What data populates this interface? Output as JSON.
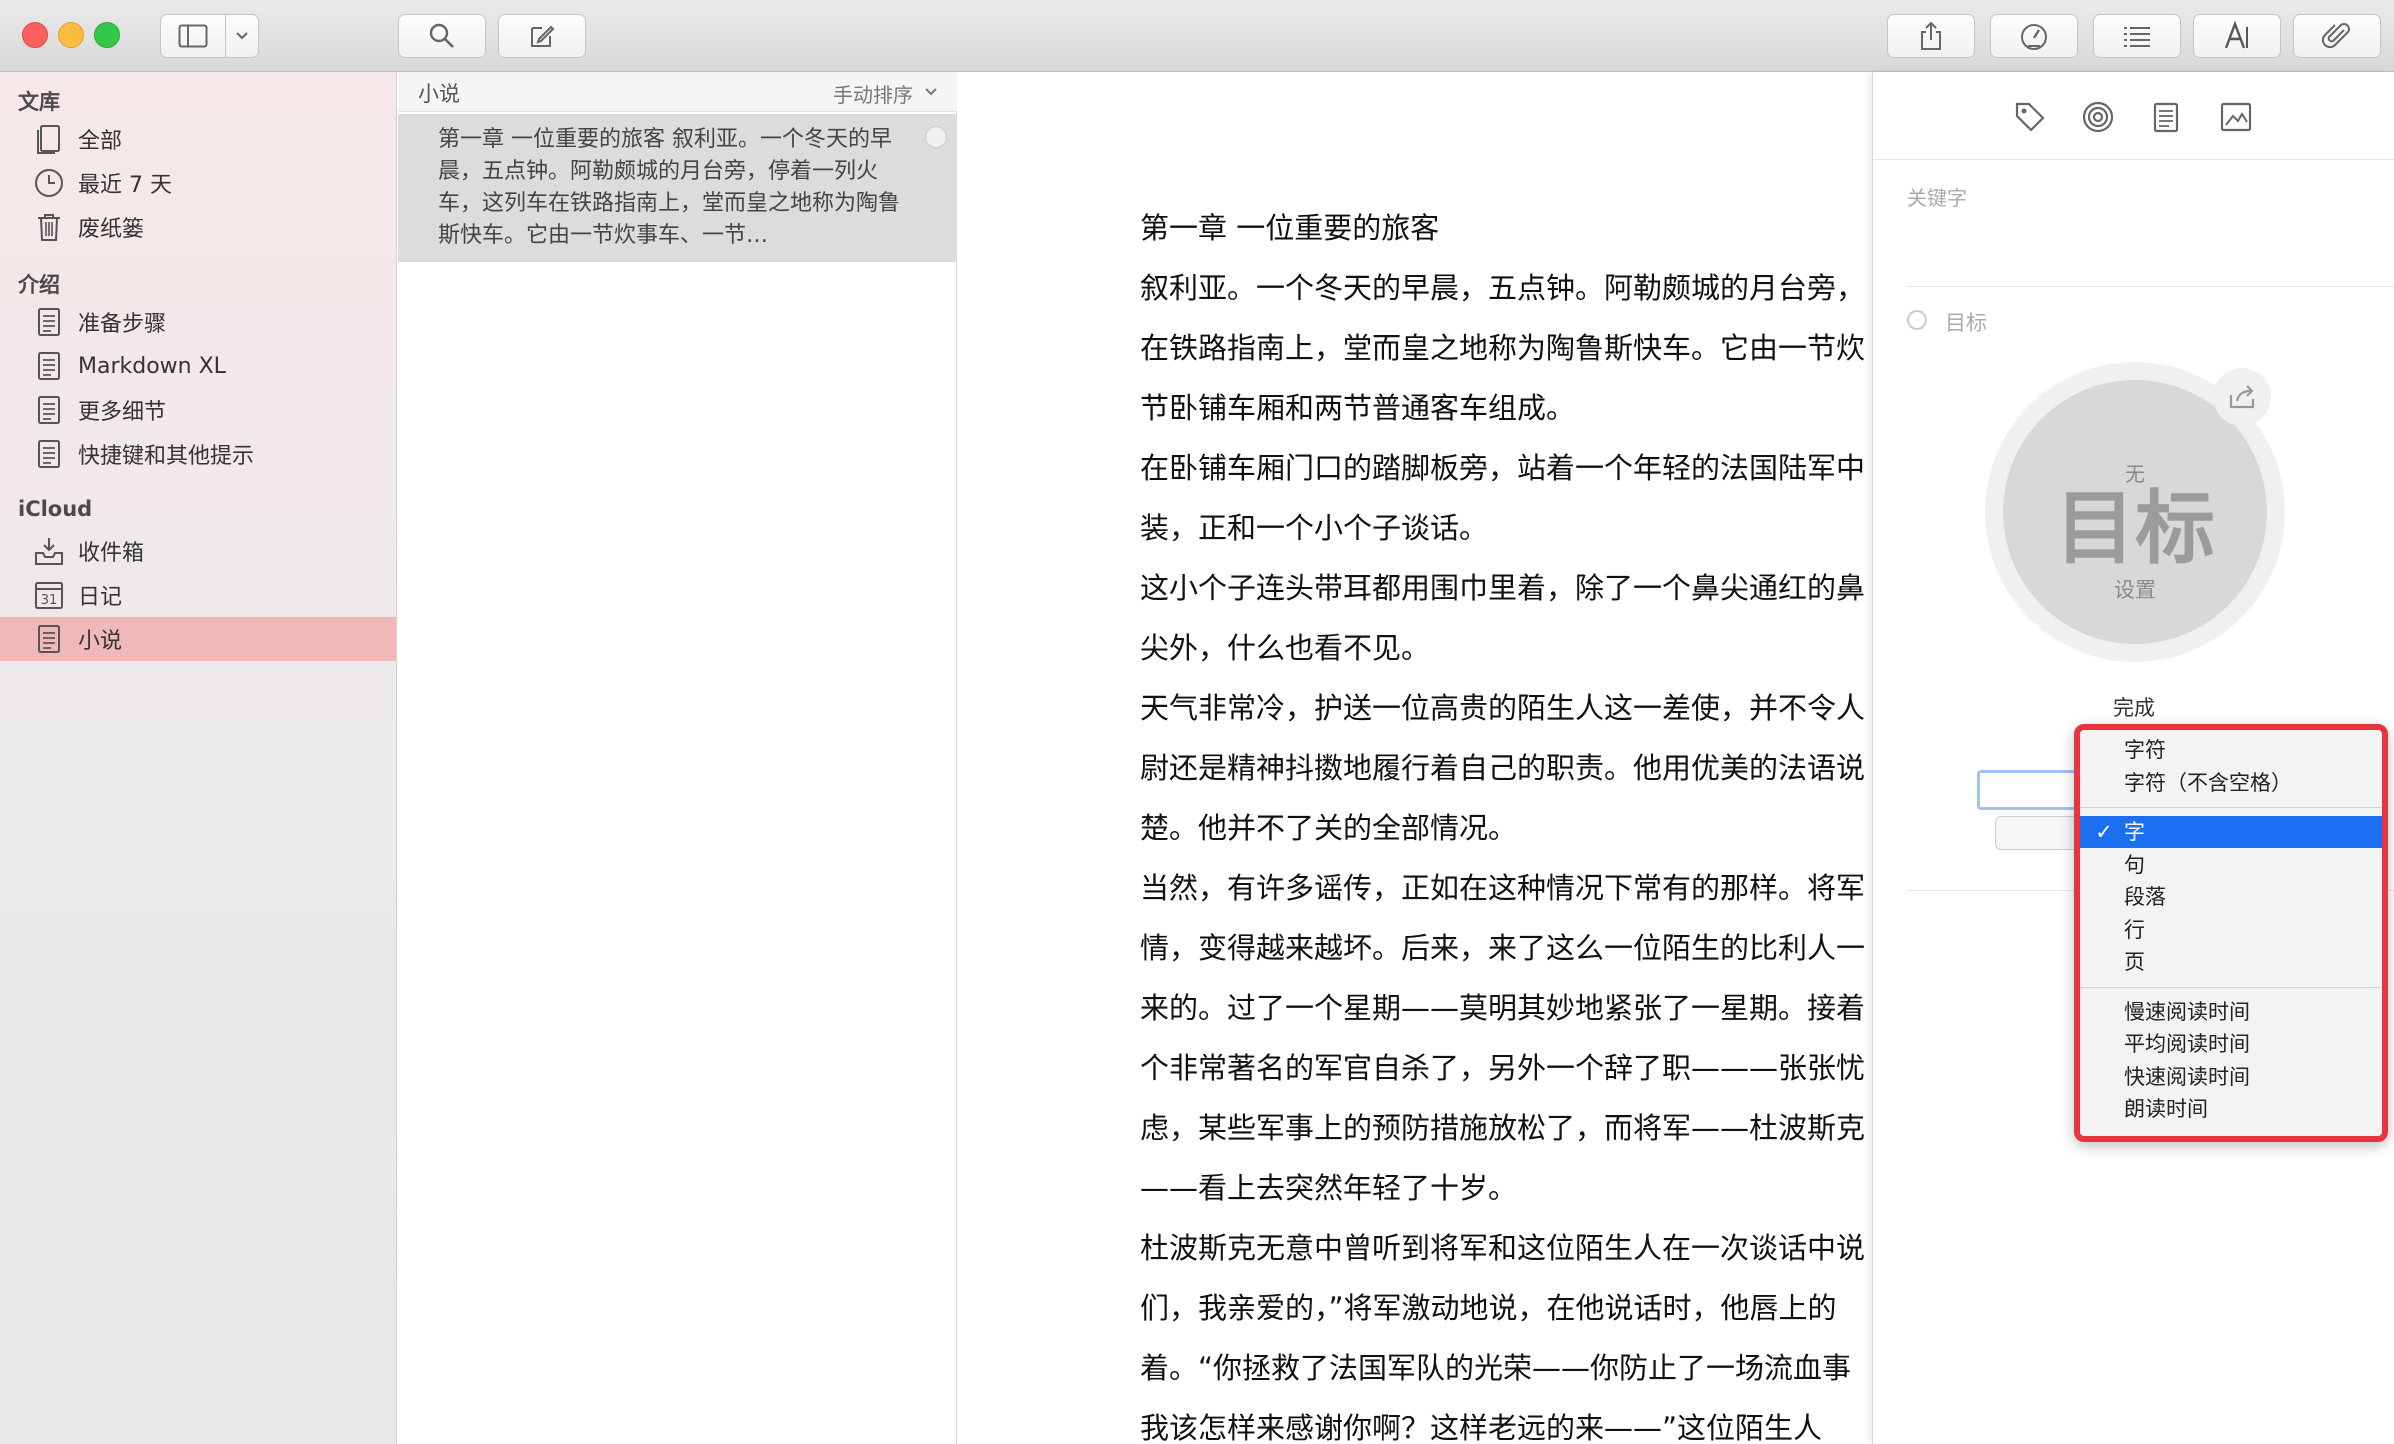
{
  "sidebar": {
    "sections": [
      {
        "title": "文库",
        "items": [
          {
            "label": "全部",
            "icon": "notes-stack-icon"
          },
          {
            "label": "最近 7 天",
            "icon": "clock-icon"
          },
          {
            "label": "废纸篓",
            "icon": "trash-icon"
          }
        ]
      },
      {
        "title": "介绍",
        "items": [
          {
            "label": "准备步骤",
            "icon": "document-icon"
          },
          {
            "label": "Markdown XL",
            "icon": "document-icon"
          },
          {
            "label": "更多细节",
            "icon": "document-icon"
          },
          {
            "label": "快捷键和其他提示",
            "icon": "document-icon"
          }
        ]
      },
      {
        "title": "iCloud",
        "items": [
          {
            "label": "收件箱",
            "icon": "inbox-icon"
          },
          {
            "label": "日记",
            "icon": "calendar-icon",
            "badge": "31"
          },
          {
            "label": "小说",
            "icon": "document-icon",
            "selected": true
          }
        ]
      }
    ]
  },
  "notelist": {
    "title": "小说",
    "sort": "手动排序",
    "items": [
      {
        "snippet": "第一章 一位重要的旅客 叙利亚。一个冬天的早晨，五点钟。阿勒颇城的月台旁，停着一列火车，这列车在铁路指南上，堂而皇之地称为陶鲁斯快车。它由一节炊事车、一节…"
      }
    ]
  },
  "editor": {
    "lines": [
      "第一章 一位重要的旅客",
      "叙利亚。一个冬天的早晨，五点钟。阿勒颇城的月台旁，",
      "在铁路指南上，堂而皇之地称为陶鲁斯快车。它由一节炊",
      "节卧铺车厢和两节普通客车组成。",
      "在卧铺车厢门口的踏脚板旁，站着一个年轻的法国陆军中",
      "装，正和一个小个子谈话。",
      "这小个子连头带耳都用围巾里着，除了一个鼻尖通红的鼻",
      "尖外，什么也看不见。",
      "天气非常冷，护送一位高贵的陌生人这一差使，并不令人",
      "尉还是精神抖擞地履行着自己的职责。他用优美的法语说",
      "楚。他并不了关的全部情况。",
      "当然，有许多谣传，正如在这种情况下常有的那样。将军",
      "情，变得越来越坏。后来，来了这么一位陌生的比利人一",
      "来的。过了一个星期——莫明其妙地紧张了一星期。接着",
      "个非常著名的军官自杀了，另外一个辞了职———张张忧",
      "虑，某些军事上的预防措施放松了，而将军——杜波斯克",
      "——看上去突然年轻了十岁。",
      "杜波斯克无意中曾听到将军和这位陌生人在一次谈话中说",
      "们，我亲爱的，”将军激动地说，在他说话时，他唇上的",
      "着。“你拯救了法国军队的光荣——你防止了一场流血事",
      "我该怎样来感谢你啊？这样老远的来——”这位陌生人"
    ]
  },
  "panel": {
    "keywords_label": "关键字",
    "goal_label": "目标",
    "ring_top": "无",
    "ring_main": "目标",
    "ring_bottom": "设置",
    "done_label": "完成"
  },
  "menu": {
    "groups": [
      [
        {
          "label": "字符"
        },
        {
          "label": "字符（不含空格）"
        }
      ],
      [
        {
          "label": "字",
          "selected": true
        },
        {
          "label": "句"
        },
        {
          "label": "段落"
        },
        {
          "label": "行"
        },
        {
          "label": "页"
        }
      ],
      [
        {
          "label": "慢速阅读时间"
        },
        {
          "label": "平均阅读时间"
        },
        {
          "label": "快速阅读时间"
        },
        {
          "label": "朗读时间"
        }
      ]
    ],
    "check_mark": "✓"
  },
  "colors": {
    "selection_sidebar": "#f0b9b7",
    "menu_highlight": "#1b6ff0",
    "annotation_border": "#e8343f"
  }
}
